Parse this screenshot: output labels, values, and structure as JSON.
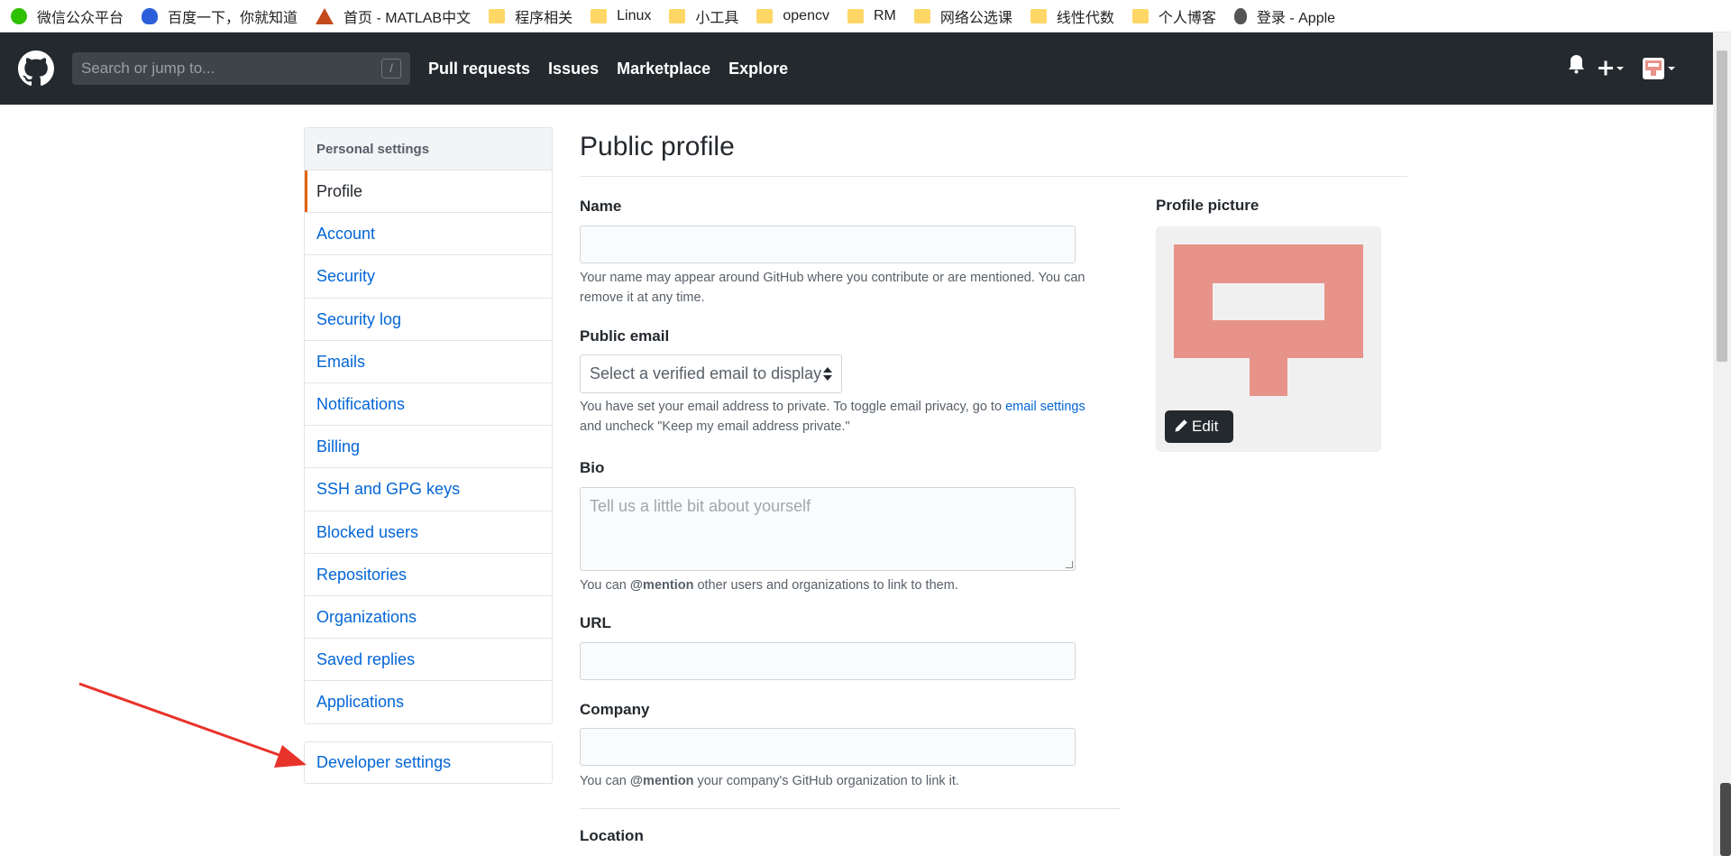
{
  "bookmarks": [
    {
      "label": "微信公众平台",
      "icon": "wechat-icon"
    },
    {
      "label": "百度一下，你就知道",
      "icon": "baidu-icon"
    },
    {
      "label": "首页 - MATLAB中文",
      "icon": "matlab-icon"
    },
    {
      "label": "程序相关",
      "icon": "folder-icon"
    },
    {
      "label": "Linux",
      "icon": "folder-icon"
    },
    {
      "label": "小工具",
      "icon": "folder-icon"
    },
    {
      "label": "opencv",
      "icon": "folder-icon"
    },
    {
      "label": "RM",
      "icon": "folder-icon"
    },
    {
      "label": "网络公选课",
      "icon": "folder-icon"
    },
    {
      "label": "线性代数",
      "icon": "folder-icon"
    },
    {
      "label": "个人博客",
      "icon": "folder-icon"
    },
    {
      "label": "登录 - Apple",
      "icon": "apple-icon"
    }
  ],
  "header": {
    "search_placeholder": "Search or jump to...",
    "search_shortcut": "/",
    "nav": [
      "Pull requests",
      "Issues",
      "Marketplace",
      "Explore"
    ]
  },
  "sidebar": {
    "heading": "Personal settings",
    "items": [
      {
        "label": "Profile"
      },
      {
        "label": "Account"
      },
      {
        "label": "Security"
      },
      {
        "label": "Security log"
      },
      {
        "label": "Emails"
      },
      {
        "label": "Notifications"
      },
      {
        "label": "Billing"
      },
      {
        "label": "SSH and GPG keys"
      },
      {
        "label": "Blocked users"
      },
      {
        "label": "Repositories"
      },
      {
        "label": "Organizations"
      },
      {
        "label": "Saved replies"
      },
      {
        "label": "Applications"
      }
    ],
    "developer_settings": "Developer settings"
  },
  "main": {
    "title": "Public profile",
    "name_label": "Name",
    "name_note": "Your name may appear around GitHub where you contribute or are mentioned. You can remove it at any time.",
    "email_label": "Public email",
    "email_select": "Select a verified email to display",
    "email_note_pre": "You have set your email address to private. To toggle email privacy, go to ",
    "email_note_link": "email settings",
    "email_note_post": " and uncheck \"Keep my email address private.\"",
    "bio_label": "Bio",
    "bio_placeholder": "Tell us a little bit about yourself",
    "bio_note_pre": "You can ",
    "bio_note_bold": "@mention",
    "bio_note_post": " other users and organizations to link to them.",
    "url_label": "URL",
    "company_label": "Company",
    "company_note_pre": "You can ",
    "company_note_bold": "@mention",
    "company_note_post": " your company's GitHub organization to link it.",
    "location_label": "Location"
  },
  "profile_picture": {
    "label": "Profile picture",
    "edit_label": "Edit",
    "avatar_color": "#e8938a"
  },
  "colors": {
    "header_bg": "#24292e",
    "link": "#0366d6",
    "selected_marker": "#e36209",
    "annotation_arrow": "#e8332a"
  }
}
